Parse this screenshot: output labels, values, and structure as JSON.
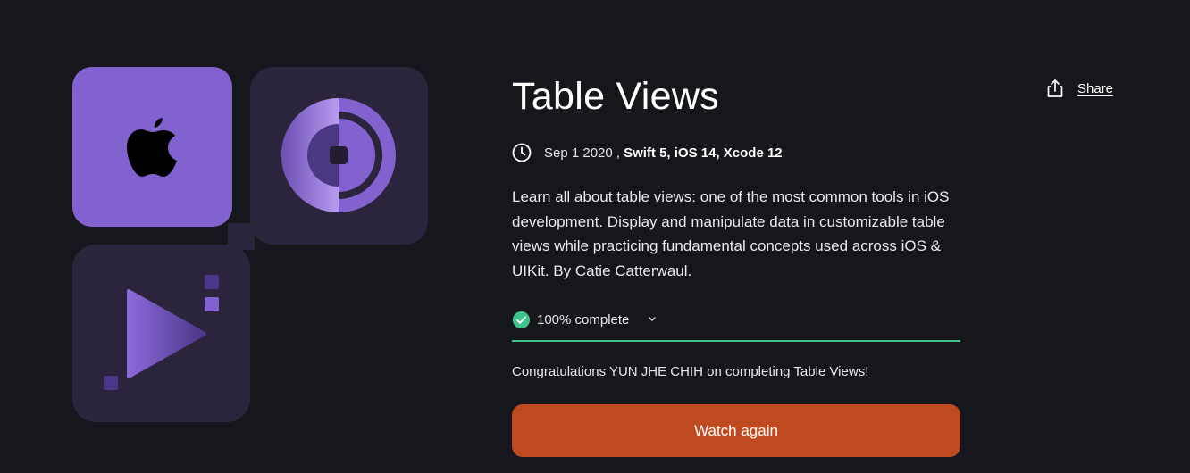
{
  "course": {
    "title": "Table Views",
    "date": "Sep 1 2020 ,",
    "tech": "Swift 5, iOS 14, Xcode 12",
    "description": "Learn all about table views: one of the most common tools in iOS development. Display and manipulate data in customizable table views while practicing fundamental concepts used across iOS & UIKit. By Catie Catterwaul."
  },
  "progress": {
    "label": "100% complete",
    "value": 1.0
  },
  "congrats": "Congratulations YUN JHE CHIH on completing Table Views!",
  "actions": {
    "watch_label": "Watch again",
    "share_label": "Share"
  },
  "colors": {
    "background": "#15171d",
    "accent_purple": "#8162cf",
    "tile_dark": "#2a243d",
    "success_green": "#3ec48a",
    "button_orange": "#c04a1f"
  },
  "icons": [
    "apple-logo-icon",
    "disc-icon",
    "play-icon",
    "clock-icon",
    "check-circle-icon",
    "chevron-down-icon",
    "share-icon"
  ]
}
